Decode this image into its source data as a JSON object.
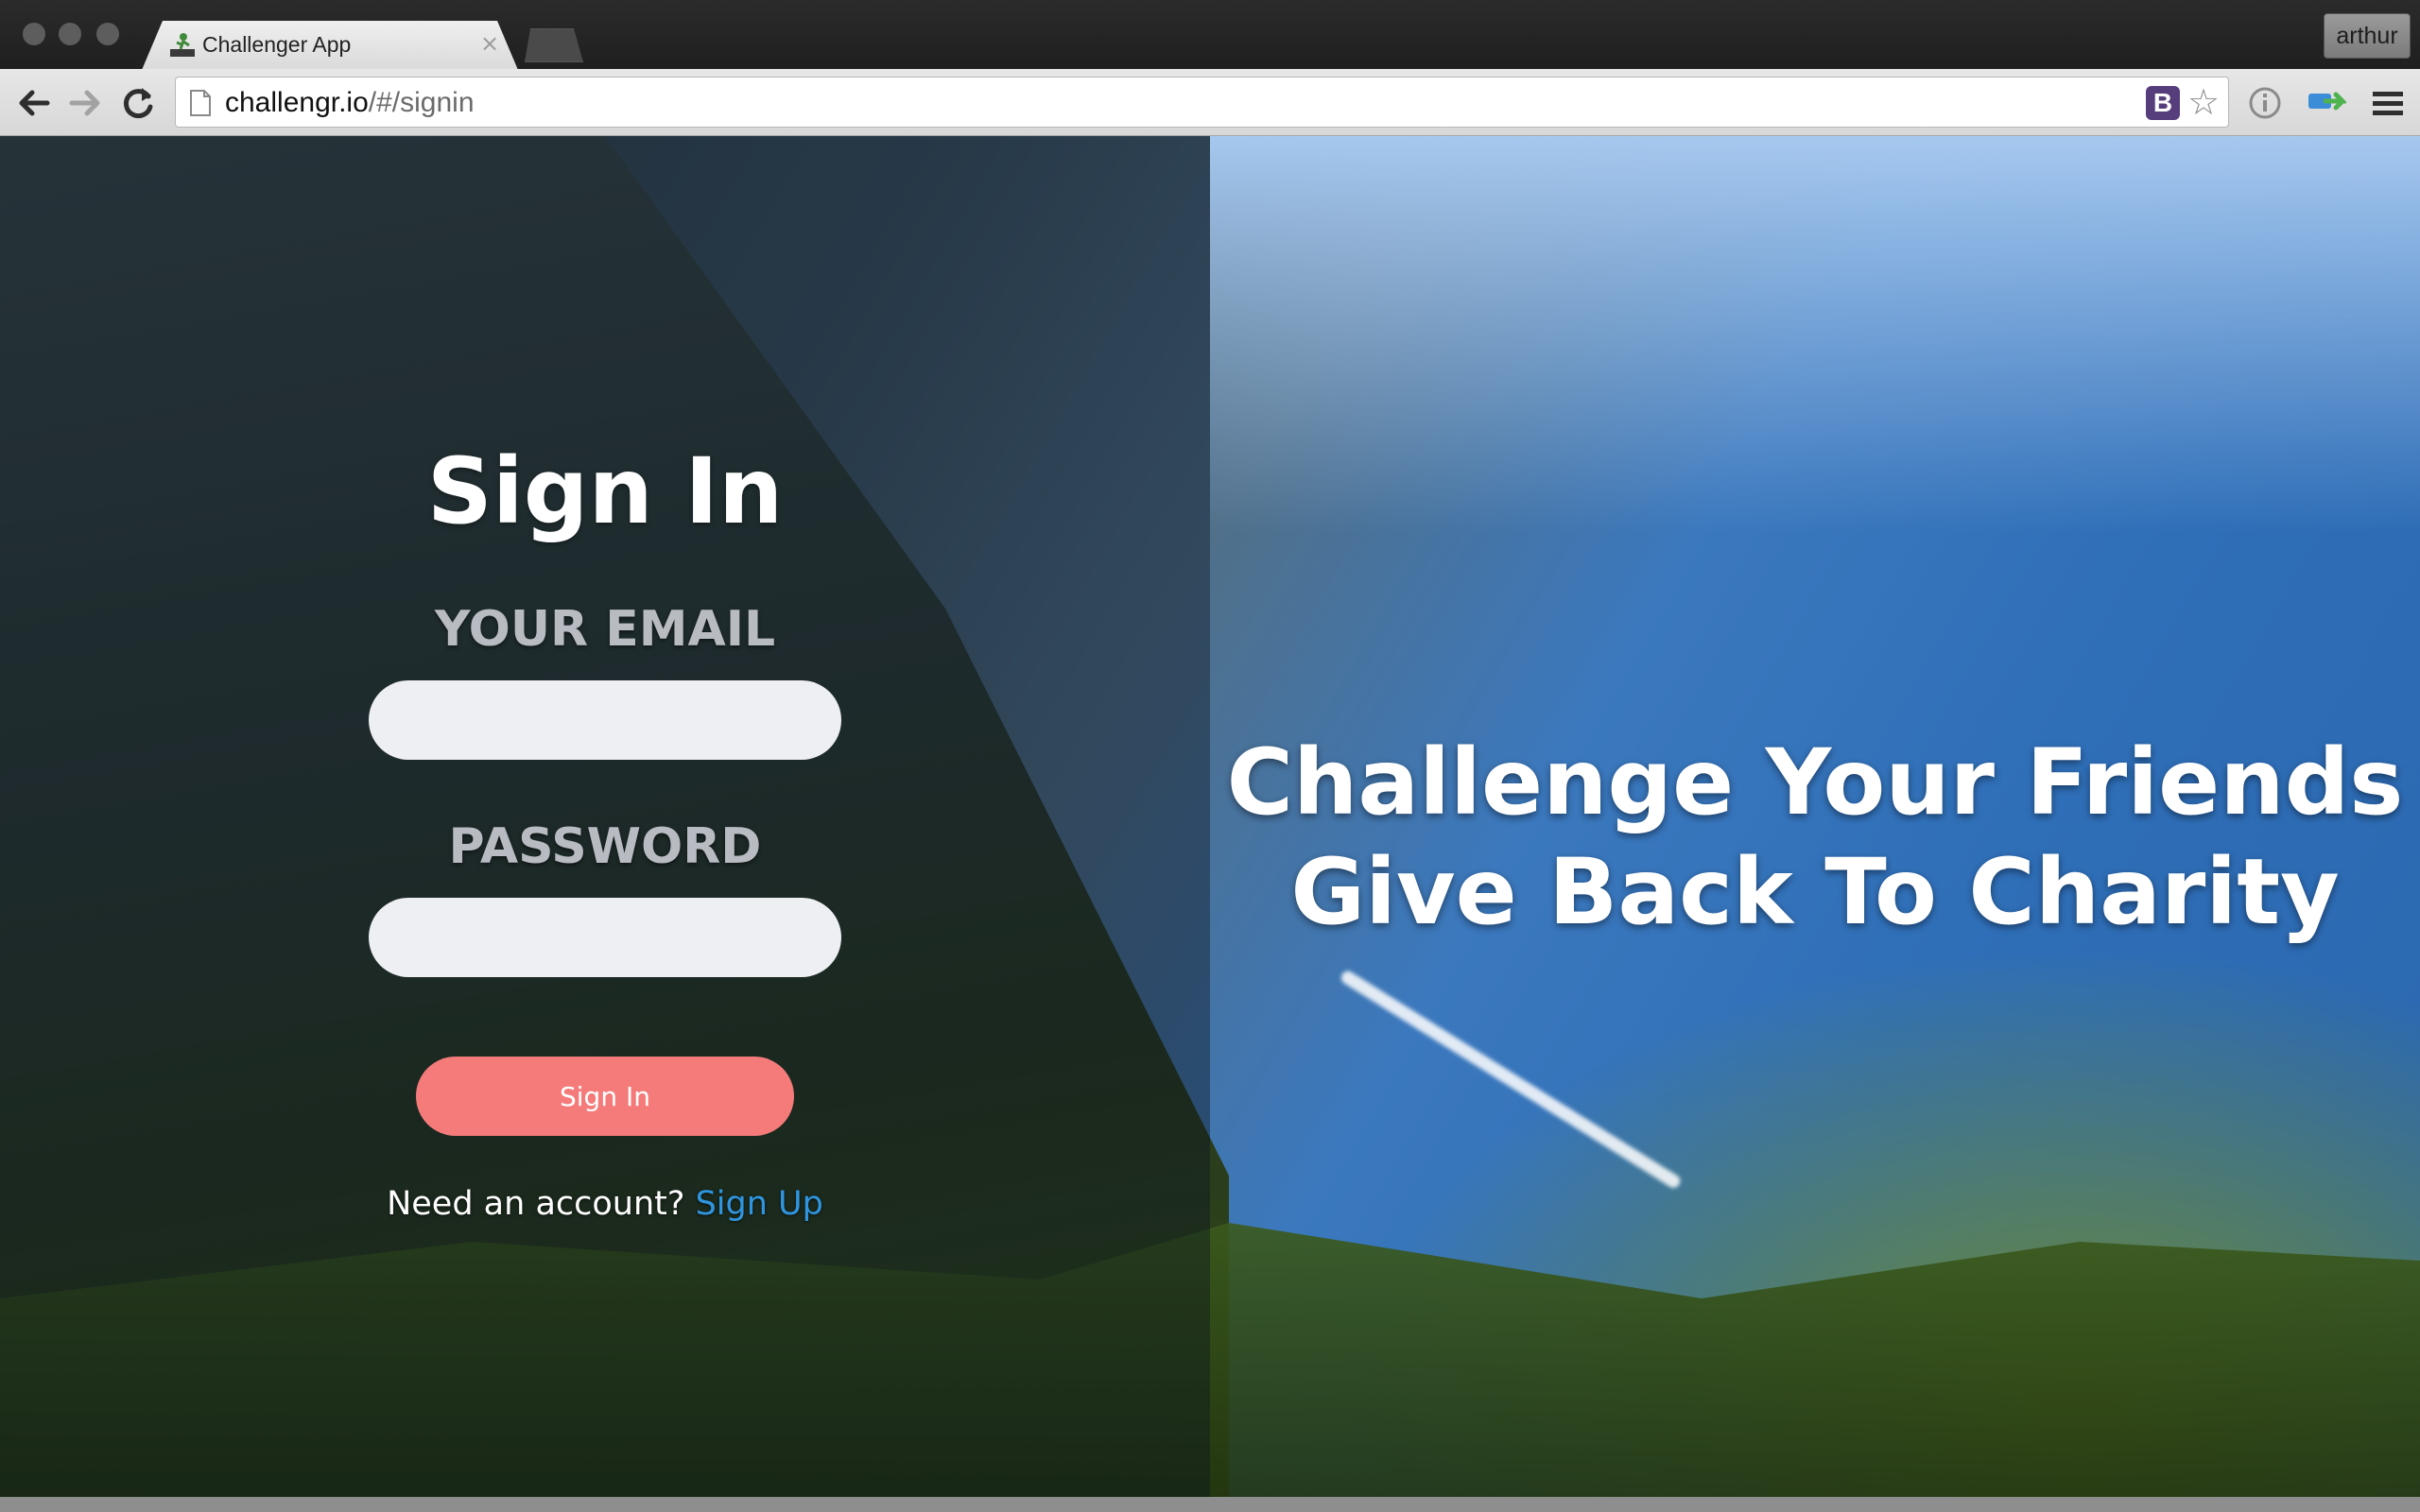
{
  "browser": {
    "tab_title": "Challenger App",
    "tab_close": "×",
    "profile_name": "arthur",
    "url_host": "challengr.io",
    "url_path": "/#/signin",
    "extension_label": "B",
    "star": "☆"
  },
  "signin": {
    "title": "Sign In",
    "email_label": "YOUR EMAIL",
    "email_value": "",
    "password_label": "PASSWORD",
    "password_value": "",
    "button_label": "Sign In",
    "account_prompt": "Need an account?",
    "signup_link": "Sign Up"
  },
  "hero": {
    "line1": "Challenge Your Friends",
    "line2": "Give Back To Charity"
  }
}
